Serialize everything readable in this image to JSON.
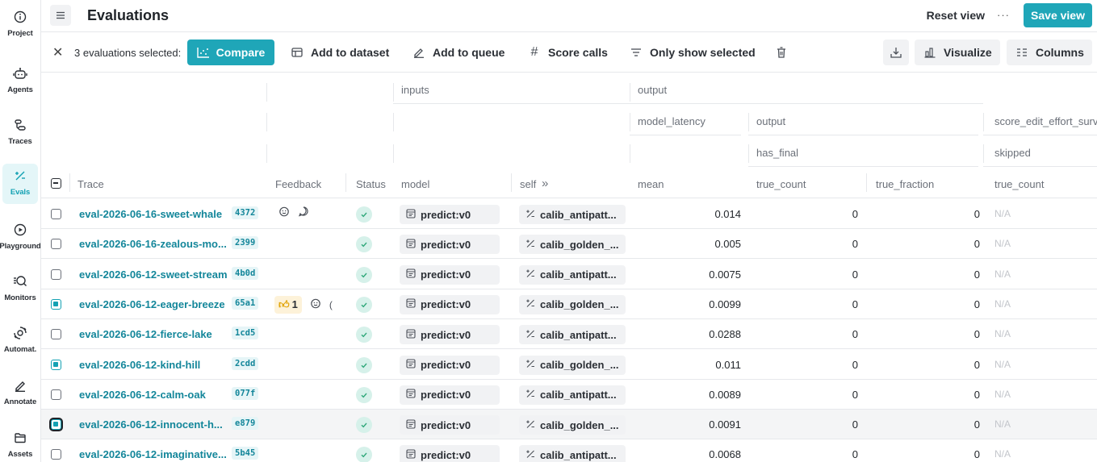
{
  "sidebar": {
    "items": [
      {
        "label": "Project",
        "icon": "info-icon"
      },
      {
        "label": "Agents",
        "icon": "robot-icon"
      },
      {
        "label": "Traces",
        "icon": "traces-icon"
      },
      {
        "label": "Evals",
        "icon": "evals-icon",
        "active": true
      },
      {
        "label": "Playground",
        "icon": "play-icon"
      },
      {
        "label": "Monitors",
        "icon": "monitor-icon"
      },
      {
        "label": "Automat.",
        "icon": "automation-icon"
      },
      {
        "label": "Annotate",
        "icon": "pencil-icon"
      },
      {
        "label": "Assets",
        "icon": "folder-icon"
      }
    ]
  },
  "header": {
    "title": "Evaluations",
    "reset_view": "Reset view",
    "more": "···",
    "save_view": "Save view"
  },
  "actions": {
    "selection_text": "3 evaluations selected:",
    "compare": "Compare",
    "add_to_dataset": "Add to dataset",
    "add_to_queue": "Add to queue",
    "score_calls": "Score calls",
    "only_show_selected": "Only show selected",
    "visualize": "Visualize",
    "columns": "Columns"
  },
  "table": {
    "group_headers": {
      "inputs": "inputs",
      "output": "output",
      "model_latency": "model_latency",
      "output_sub": "output",
      "score_edit": "score_edit_effort_surv",
      "has_final": "has_final",
      "skipped": "skipped"
    },
    "columns": {
      "trace": "Trace",
      "feedback": "Feedback",
      "status": "Status",
      "model": "model",
      "self": "self",
      "self_expand": "»",
      "mean": "mean",
      "true_count": "true_count",
      "true_fraction": "true_fraction",
      "true_count_2": "true_count"
    },
    "rows": [
      {
        "name": "eval-2026-06-16-sweet-whale",
        "id": "4372",
        "model": "predict:v0",
        "self": "calib_antipatt...",
        "mean": "0.014",
        "true_count": "0",
        "true_fraction": "0",
        "na": "N/A",
        "feedback": "icons",
        "selected": false
      },
      {
        "name": "eval-2026-06-16-zealous-mo...",
        "id": "2399",
        "model": "predict:v0",
        "self": "calib_golden_...",
        "mean": "0.005",
        "true_count": "0",
        "true_fraction": "0",
        "na": "N/A",
        "feedback": "",
        "selected": false
      },
      {
        "name": "eval-2026-06-12-sweet-stream",
        "id": "4b0d",
        "model": "predict:v0",
        "self": "calib_antipatt...",
        "mean": "0.0075",
        "true_count": "0",
        "true_fraction": "0",
        "na": "N/A",
        "feedback": "",
        "selected": false
      },
      {
        "name": "eval-2026-06-12-eager-breeze",
        "id": "65a1",
        "model": "predict:v0",
        "self": "calib_golden_...",
        "mean": "0.0099",
        "true_count": "0",
        "true_fraction": "0",
        "na": "N/A",
        "feedback": "thumb",
        "thumb_count": "1",
        "selected": true
      },
      {
        "name": "eval-2026-06-12-fierce-lake",
        "id": "1cd5",
        "model": "predict:v0",
        "self": "calib_antipatt...",
        "mean": "0.0288",
        "true_count": "0",
        "true_fraction": "0",
        "na": "N/A",
        "feedback": "",
        "selected": false
      },
      {
        "name": "eval-2026-06-12-kind-hill",
        "id": "2cdd",
        "model": "predict:v0",
        "self": "calib_golden_...",
        "mean": "0.011",
        "true_count": "0",
        "true_fraction": "0",
        "na": "N/A",
        "feedback": "",
        "selected": true
      },
      {
        "name": "eval-2026-06-12-calm-oak",
        "id": "077f",
        "model": "predict:v0",
        "self": "calib_antipatt...",
        "mean": "0.0089",
        "true_count": "0",
        "true_fraction": "0",
        "na": "N/A",
        "feedback": "",
        "selected": false
      },
      {
        "name": "eval-2026-06-12-innocent-h...",
        "id": "e879",
        "model": "predict:v0",
        "self": "calib_golden_...",
        "mean": "0.0091",
        "true_count": "0",
        "true_fraction": "0",
        "na": "N/A",
        "feedback": "",
        "selected": true,
        "highlight": true
      },
      {
        "name": "eval-2026-06-12-imaginative...",
        "id": "5b45",
        "model": "predict:v0",
        "self": "calib_antipatt...",
        "mean": "0.0068",
        "true_count": "0",
        "true_fraction": "0",
        "na": "N/A",
        "feedback": "",
        "selected": false
      }
    ]
  },
  "colors": {
    "accent": "#1fa6b8",
    "link": "#13869a",
    "status_ok": "#2fa87a"
  }
}
